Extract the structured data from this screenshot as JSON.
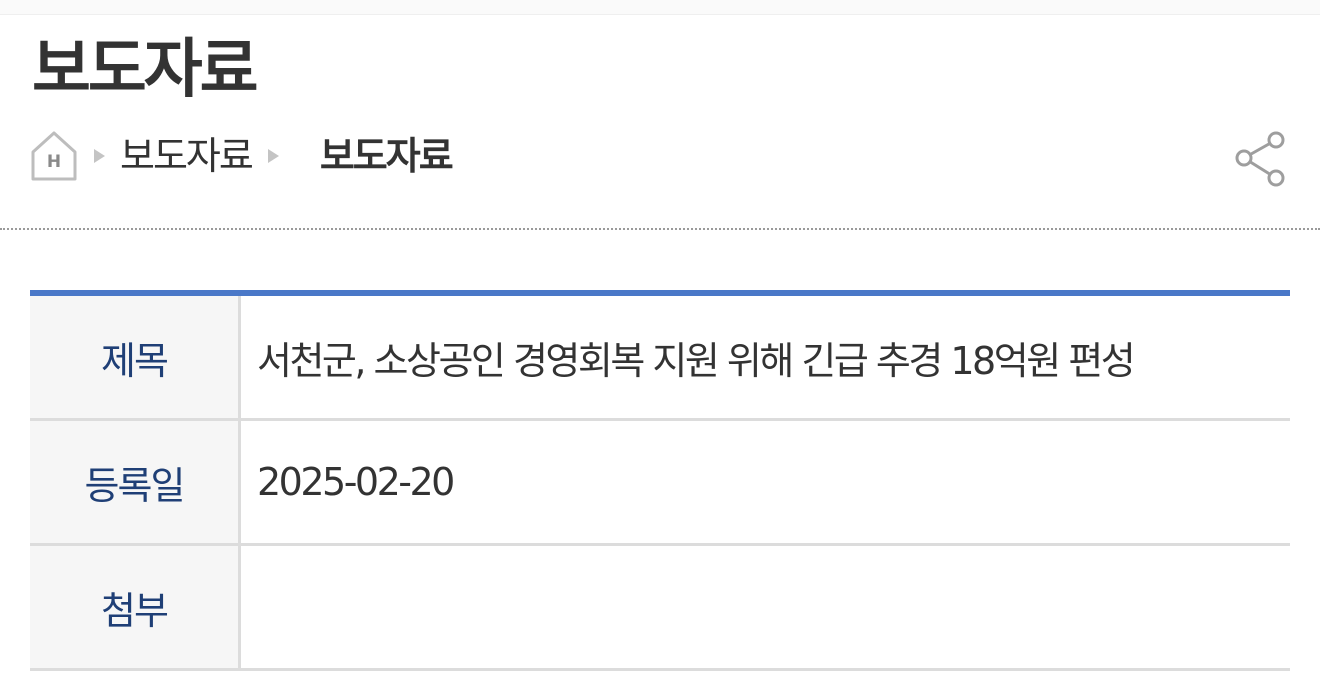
{
  "header": {
    "title": "보도자료"
  },
  "breadcrumb": {
    "home_icon": "home-icon",
    "items": [
      "보도자료",
      "보도자료"
    ]
  },
  "share": {
    "icon": "share-icon"
  },
  "detail": {
    "rows": [
      {
        "label": "제목",
        "value": "서천군, 소상공인 경영회복 지원 위해 긴급 추경 18억원 편성"
      },
      {
        "label": "등록일",
        "value": "2025-02-20"
      },
      {
        "label": "첨부",
        "value": ""
      }
    ]
  },
  "colors": {
    "accent_border": "#4a78c8",
    "label_text": "#1f3f76",
    "body_text": "#333333",
    "label_bg": "#f6f6f6"
  }
}
